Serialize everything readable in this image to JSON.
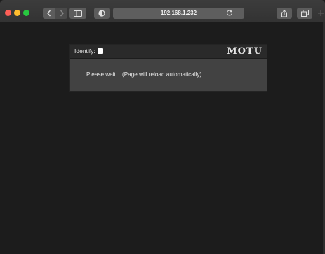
{
  "browser": {
    "address": "192.168.1.232"
  },
  "panel": {
    "identify_label": "Identify:",
    "brand": "MOTU",
    "message": "Please wait... (Page will reload automatically)"
  }
}
